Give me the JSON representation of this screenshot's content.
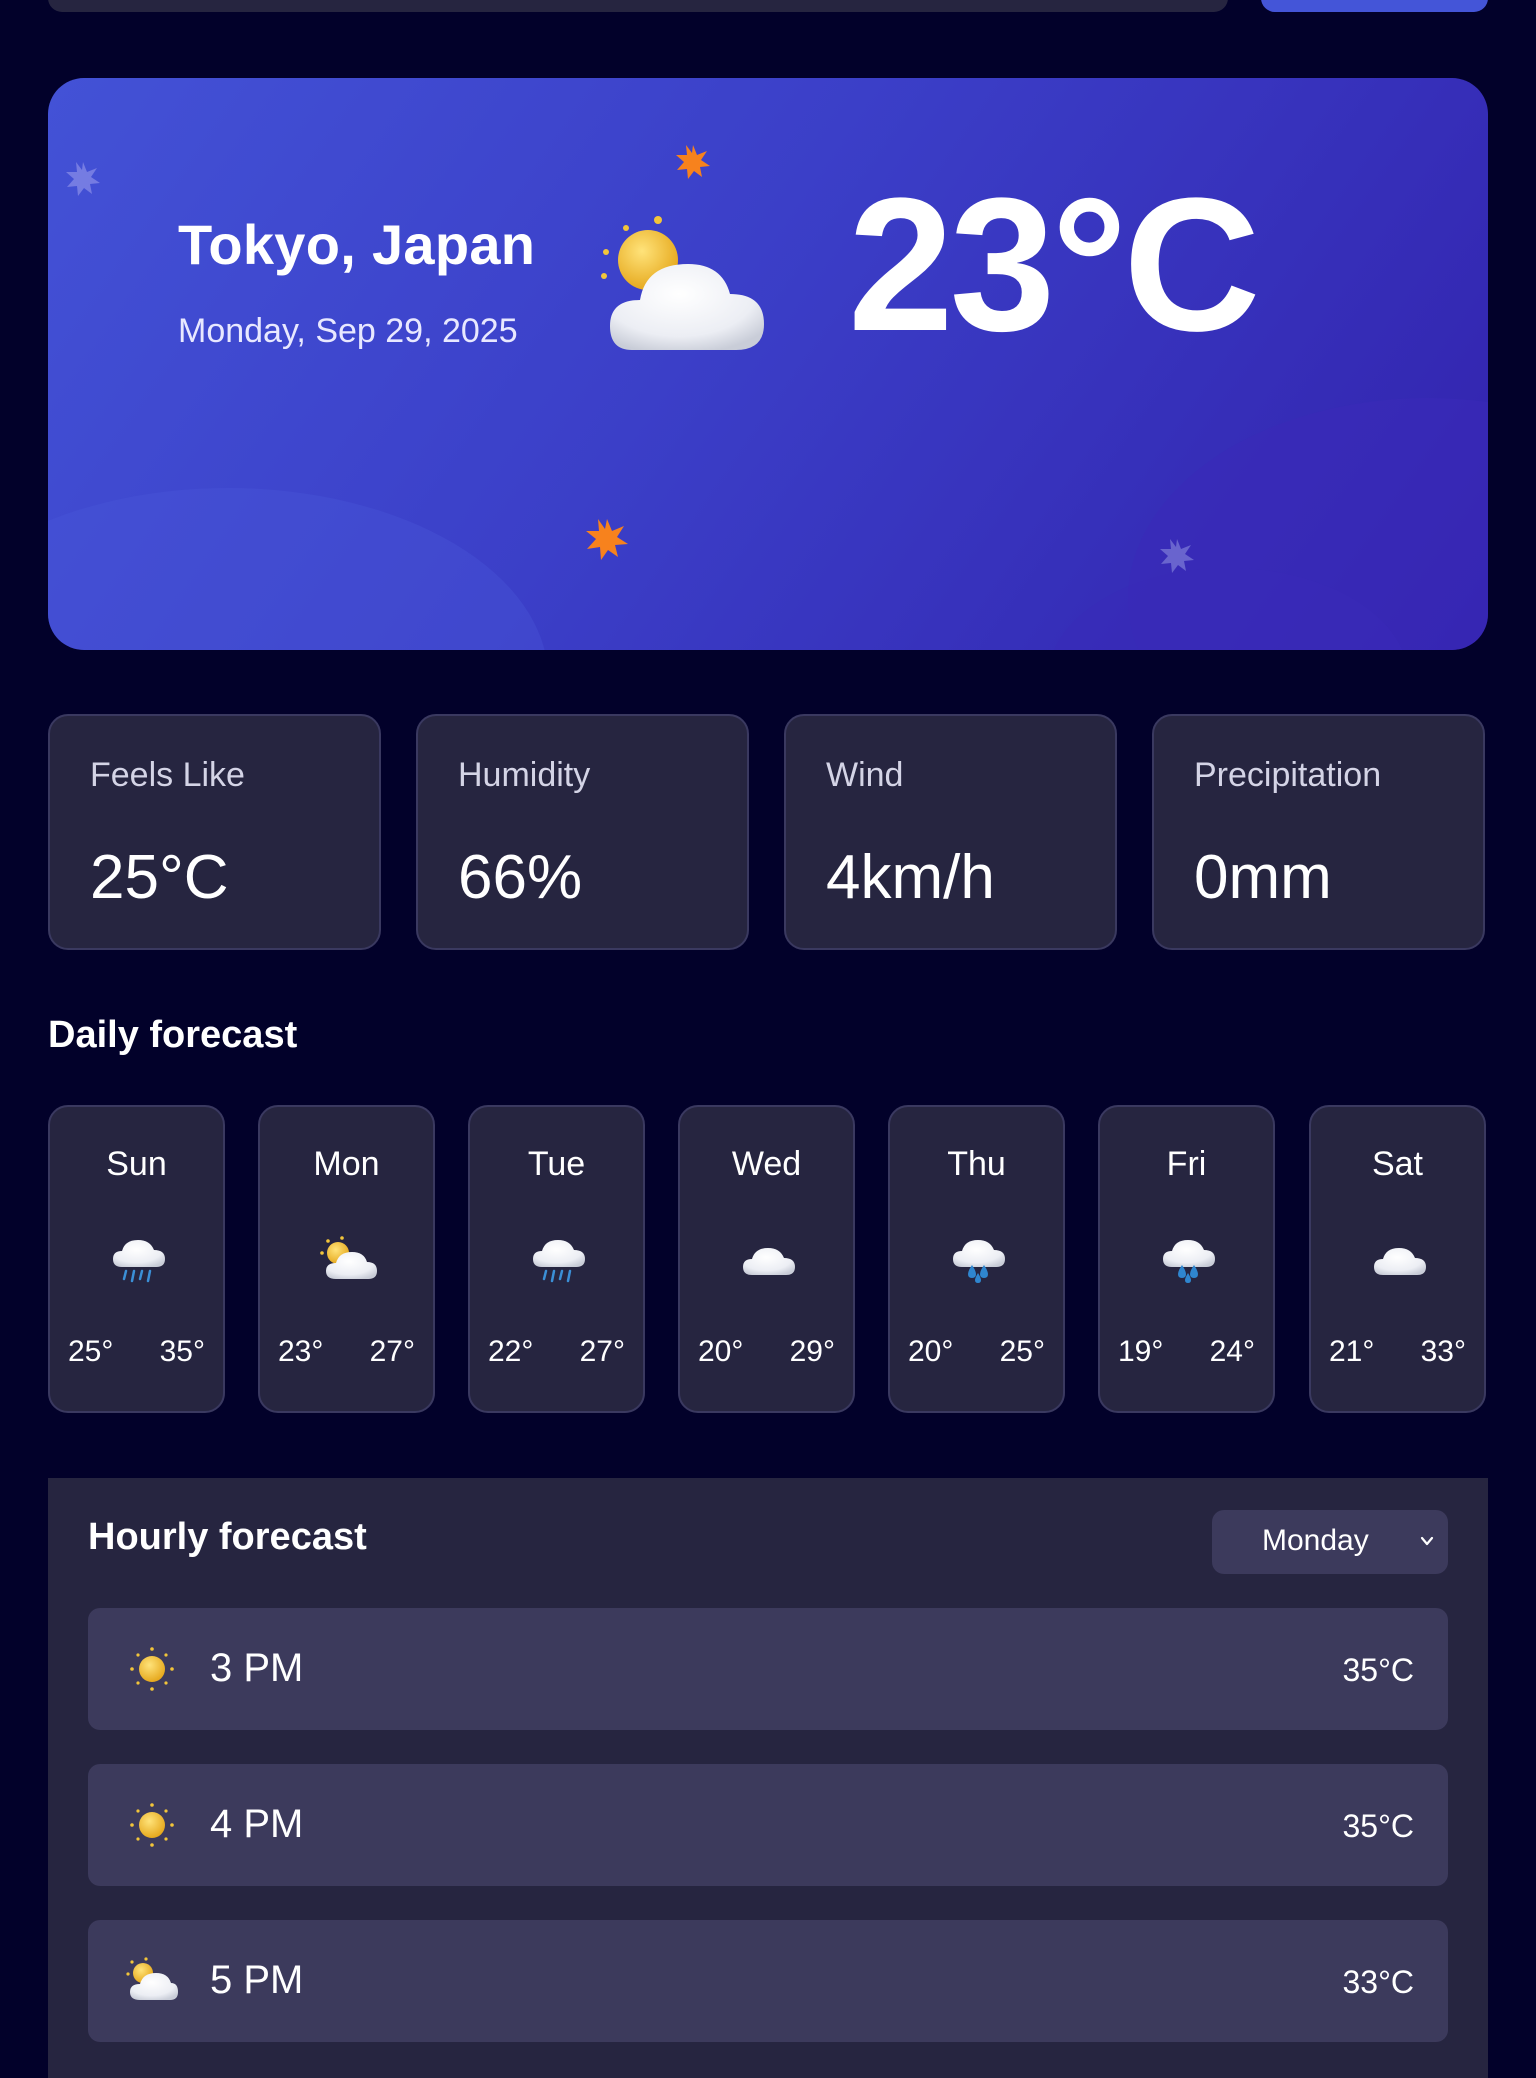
{
  "search": {
    "placeholder": "",
    "button_label": ""
  },
  "current": {
    "location": "Tokyo, Japan",
    "date": "Monday, Sep 29, 2025",
    "temperature": "23°C",
    "icon": "partly-cloudy-icon"
  },
  "stats": [
    {
      "label": "Feels Like",
      "value": "25°C"
    },
    {
      "label": "Humidity",
      "value": "66%"
    },
    {
      "label": "Wind",
      "value": "4km/h"
    },
    {
      "label": "Precipitation",
      "value": "0mm"
    }
  ],
  "daily": {
    "title": "Daily forecast",
    "days": [
      {
        "day": "Sun",
        "icon": "rain-icon",
        "low": "25°",
        "high": "35°"
      },
      {
        "day": "Mon",
        "icon": "partly-cloudy-icon",
        "low": "23°",
        "high": "27°"
      },
      {
        "day": "Tue",
        "icon": "rain-icon",
        "low": "22°",
        "high": "27°"
      },
      {
        "day": "Wed",
        "icon": "cloud-icon",
        "low": "20°",
        "high": "29°"
      },
      {
        "day": "Thu",
        "icon": "heavy-rain-icon",
        "low": "20°",
        "high": "25°"
      },
      {
        "day": "Fri",
        "icon": "heavy-rain-icon",
        "low": "19°",
        "high": "24°"
      },
      {
        "day": "Sat",
        "icon": "cloud-icon",
        "low": "21°",
        "high": "33°"
      }
    ]
  },
  "hourly": {
    "title": "Hourly forecast",
    "selected_day": "Monday",
    "hours": [
      {
        "time": "3 PM",
        "icon": "sun-icon",
        "temp": "35°C"
      },
      {
        "time": "4 PM",
        "icon": "sun-icon",
        "temp": "35°C"
      },
      {
        "time": "5 PM",
        "icon": "partly-cloudy-icon",
        "temp": "33°C"
      }
    ]
  },
  "colors": {
    "background": "#02012a",
    "card": "#262540",
    "row": "#3c3a5c",
    "hero_start": "#4352d6",
    "hero_end": "#3222ad",
    "accent": "#4455d8",
    "sun": "#f2c53a",
    "spark": "#f7821d"
  }
}
